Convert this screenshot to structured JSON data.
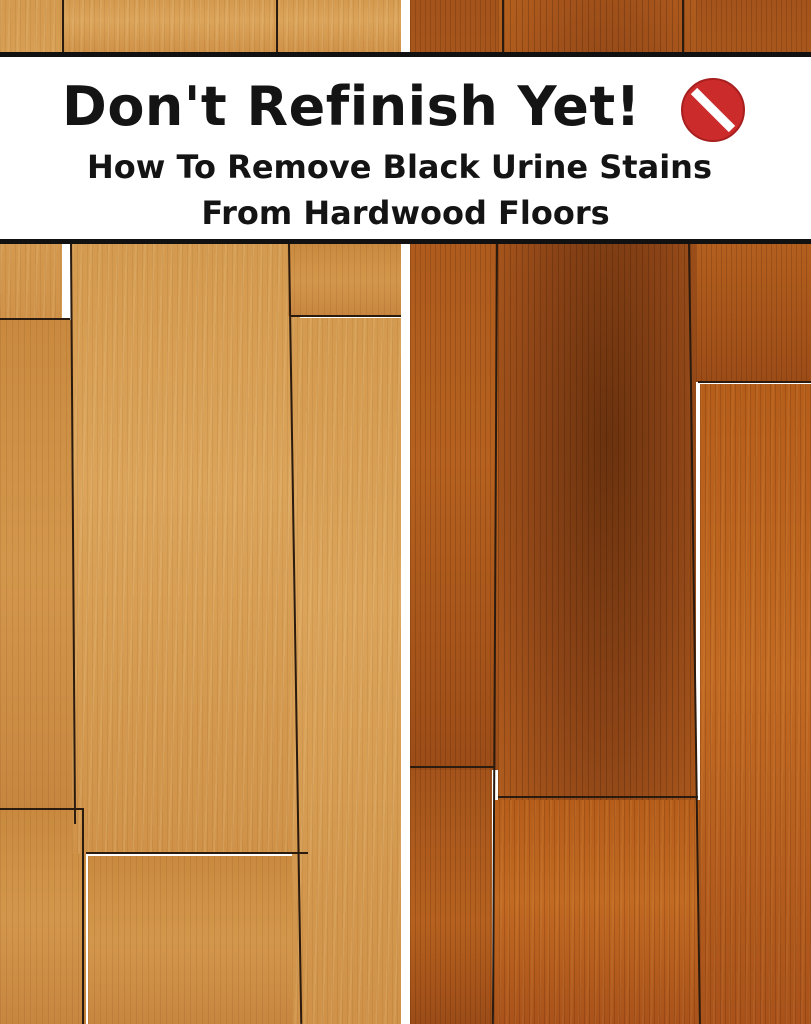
{
  "banner": {
    "title": "Don't Refinish Yet!",
    "subtitle_line1": "How To Remove Black Urine Stains",
    "subtitle_line2": "From Hardwood Floors",
    "icon": "no-entry-icon"
  },
  "colors": {
    "banner_background": "#ffffff",
    "banner_border": "#111111",
    "text": "#141414",
    "icon_red": "#cc2b2b",
    "clean_wood": "#d49a4f",
    "stained_wood": "#b55d1a",
    "stain_dark": "#6a320e"
  }
}
